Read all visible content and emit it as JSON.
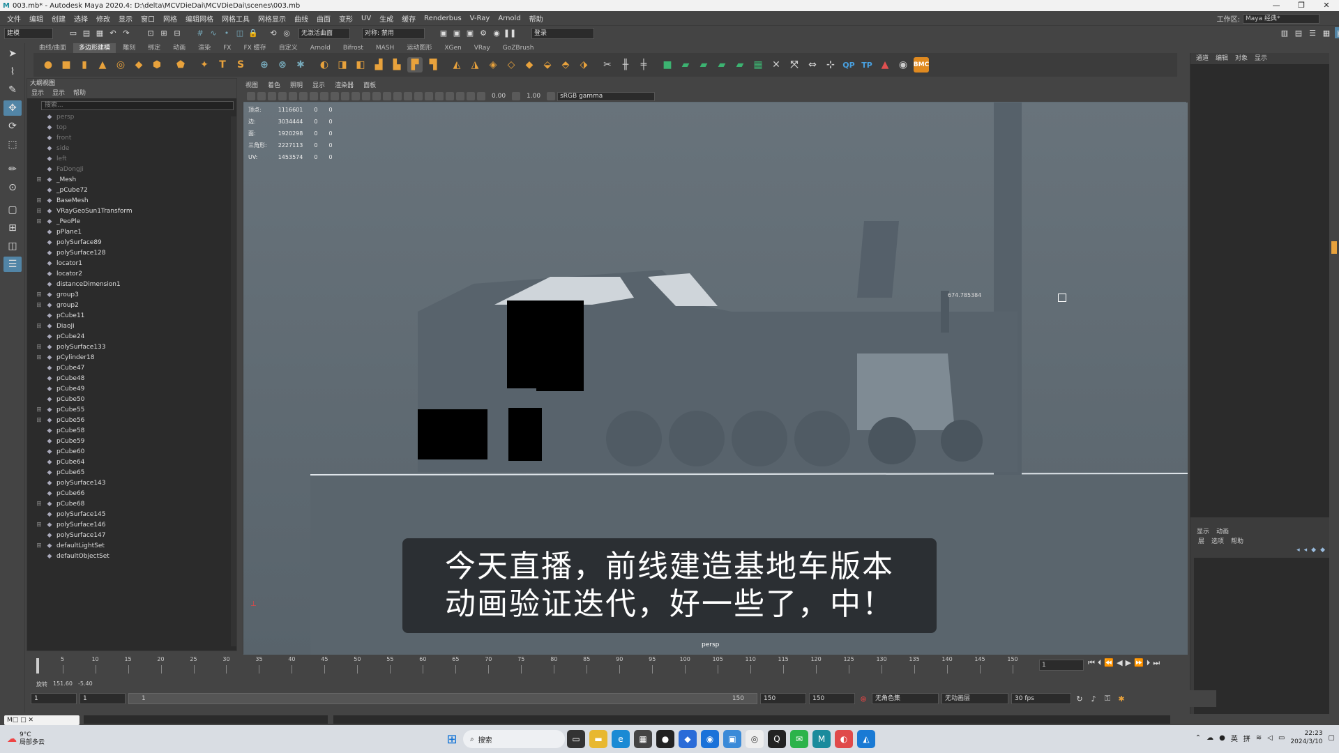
{
  "window": {
    "title": "003.mb* - Autodesk Maya 2020.4: D:\\delta\\MCVDieDai\\MCVDieDai\\scenes\\003.mb"
  },
  "menu": [
    "文件",
    "编辑",
    "创建",
    "选择",
    "修改",
    "显示",
    "窗口",
    "网格",
    "编辑网格",
    "网格工具",
    "网格显示",
    "曲线",
    "曲面",
    "变形",
    "UV",
    "生成",
    "缓存",
    "Renderbus",
    "V-Ray",
    "Arnold",
    "帮助"
  ],
  "workspace": {
    "label": "工作区:",
    "value": "Maya 经典*"
  },
  "statusline": {
    "mode": "建模",
    "live_surface": "无激活曲面",
    "symmetry": "对称: 禁用",
    "login": "登录"
  },
  "shelf_tabs": [
    "曲线/曲面",
    "多边形建模",
    "雕刻",
    "绑定",
    "动画",
    "渲染",
    "FX",
    "FX 缓存",
    "自定义",
    "Arnold",
    "Bifrost",
    "MASH",
    "运动图形",
    "XGen",
    "VRay",
    "GoZBrush"
  ],
  "shelf_active": "多边形建模",
  "outliner": {
    "title": "大纲视图",
    "menu": [
      "显示",
      "显示",
      "帮助"
    ],
    "search_placeholder": "搜索...",
    "items": [
      {
        "name": "persp",
        "dim": true,
        "exp": ""
      },
      {
        "name": "top",
        "dim": true,
        "exp": ""
      },
      {
        "name": "front",
        "dim": true,
        "exp": ""
      },
      {
        "name": "side",
        "dim": true,
        "exp": ""
      },
      {
        "name": "left",
        "dim": true,
        "exp": ""
      },
      {
        "name": "FaDongJi",
        "dim": true,
        "exp": ""
      },
      {
        "name": "_Mesh",
        "dim": false,
        "exp": "+"
      },
      {
        "name": "_pCube72",
        "dim": false,
        "exp": ""
      },
      {
        "name": "BaseMesh",
        "dim": false,
        "exp": "+"
      },
      {
        "name": "VRayGeoSun1Transform",
        "dim": false,
        "exp": "+"
      },
      {
        "name": "_PeoPle",
        "dim": false,
        "exp": "+"
      },
      {
        "name": "pPlane1",
        "dim": false,
        "exp": ""
      },
      {
        "name": "polySurface89",
        "dim": false,
        "exp": ""
      },
      {
        "name": "polySurface128",
        "dim": false,
        "exp": ""
      },
      {
        "name": "locator1",
        "dim": false,
        "exp": ""
      },
      {
        "name": "locator2",
        "dim": false,
        "exp": ""
      },
      {
        "name": "distanceDimension1",
        "dim": false,
        "exp": ""
      },
      {
        "name": "group3",
        "dim": false,
        "exp": "+"
      },
      {
        "name": "group2",
        "dim": false,
        "exp": "+"
      },
      {
        "name": "pCube11",
        "dim": false,
        "exp": ""
      },
      {
        "name": "DiaoJi",
        "dim": false,
        "exp": "+"
      },
      {
        "name": "pCube24",
        "dim": false,
        "exp": ""
      },
      {
        "name": "polySurface133",
        "dim": false,
        "exp": "+"
      },
      {
        "name": "pCylinder18",
        "dim": false,
        "exp": "+"
      },
      {
        "name": "pCube47",
        "dim": false,
        "exp": ""
      },
      {
        "name": "pCube48",
        "dim": false,
        "exp": ""
      },
      {
        "name": "pCube49",
        "dim": false,
        "exp": ""
      },
      {
        "name": "pCube50",
        "dim": false,
        "exp": ""
      },
      {
        "name": "pCube55",
        "dim": false,
        "exp": "+"
      },
      {
        "name": "pCube56",
        "dim": false,
        "exp": "+"
      },
      {
        "name": "pCube58",
        "dim": false,
        "exp": ""
      },
      {
        "name": "pCube59",
        "dim": false,
        "exp": ""
      },
      {
        "name": "pCube60",
        "dim": false,
        "exp": ""
      },
      {
        "name": "pCube64",
        "dim": false,
        "exp": ""
      },
      {
        "name": "pCube65",
        "dim": false,
        "exp": ""
      },
      {
        "name": "polySurface143",
        "dim": false,
        "exp": ""
      },
      {
        "name": "pCube66",
        "dim": false,
        "exp": ""
      },
      {
        "name": "pCube68",
        "dim": false,
        "exp": "+"
      },
      {
        "name": "polySurface145",
        "dim": false,
        "exp": ""
      },
      {
        "name": "polySurface146",
        "dim": false,
        "exp": "+"
      },
      {
        "name": "polySurface147",
        "dim": false,
        "exp": ""
      },
      {
        "name": "defaultLightSet",
        "dim": false,
        "exp": "+"
      },
      {
        "name": "defaultObjectSet",
        "dim": false,
        "exp": ""
      }
    ]
  },
  "viewport": {
    "menu": [
      "视图",
      "着色",
      "照明",
      "显示",
      "渲染器",
      "面板"
    ],
    "exposure": "0.00",
    "gamma": "1.00",
    "colorspace": "sRGB gamma",
    "camera": "persp",
    "hud": [
      {
        "label": "顶点:",
        "a": "1116601",
        "b": "0",
        "c": "0"
      },
      {
        "label": "边:",
        "a": "3034444",
        "b": "0",
        "c": "0"
      },
      {
        "label": "面:",
        "a": "1920298",
        "b": "0",
        "c": "0"
      },
      {
        "label": "三角形:",
        "a": "2227113",
        "b": "0",
        "c": "0"
      },
      {
        "label": "UV:",
        "a": "1453574",
        "b": "0",
        "c": "0"
      }
    ],
    "measure": "674.785384"
  },
  "subtitle": {
    "line1": "今天直播，前线建造基地车版本",
    "line2": "动画验证迭代，好一些了，中！"
  },
  "right_panel": {
    "menu": [
      "通道",
      "编辑",
      "对象",
      "显示"
    ],
    "layer_tabs": [
      "显示",
      "动画"
    ],
    "layer_menu": [
      "层",
      "选项",
      "帮助"
    ]
  },
  "timeline": {
    "ticks": [
      "5",
      "10",
      "15",
      "20",
      "25",
      "30",
      "35",
      "40",
      "45",
      "50",
      "55",
      "60",
      "65",
      "70",
      "75",
      "80",
      "85",
      "90",
      "95",
      "100",
      "105",
      "110",
      "115",
      "120",
      "125",
      "130",
      "135",
      "140",
      "145",
      "150"
    ],
    "current": "1"
  },
  "coords": {
    "label": "旋转",
    "x": "151.60",
    "y": "-5.40"
  },
  "range": {
    "start": "1",
    "start2": "1",
    "slider_start": "1",
    "slider_end": "150",
    "end": "150",
    "end2": "150",
    "charset": "无角色集",
    "animlayer": "无动画层",
    "fps": "30 fps"
  },
  "taskbar": {
    "weather_temp": "9°C",
    "weather_desc": "局部多云",
    "search": "搜索",
    "ime1": "英",
    "ime2": "拼",
    "time": "22:23",
    "date": "2024/3/10"
  }
}
